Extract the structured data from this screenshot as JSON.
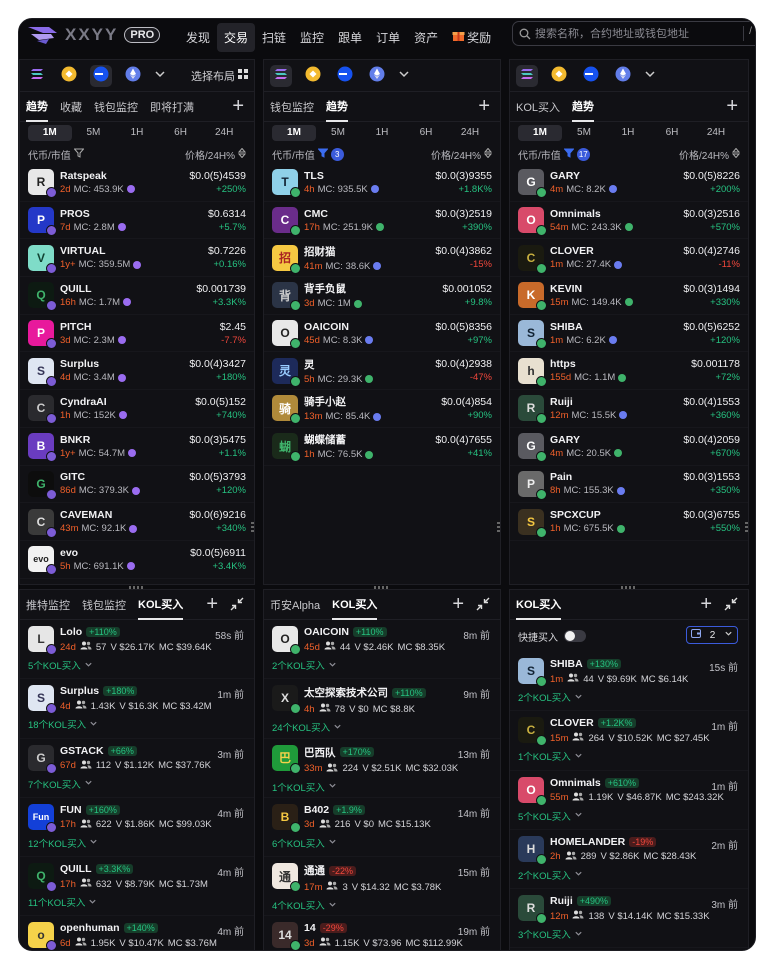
{
  "brand": {
    "logo_text": "XXYY",
    "badge": "PRO"
  },
  "nav": [
    "发现",
    "交易",
    "扫链",
    "监控",
    "跟单",
    "订单",
    "资产",
    "奖励"
  ],
  "nav_active": 1,
  "search": {
    "placeholder": "搜索名称，合约地址或钱包地址",
    "shortcut": "/"
  },
  "colors": {
    "up": "#26c281",
    "down": "#f0473c",
    "age": "#f0602a",
    "accent": "#3b5bdb"
  },
  "layout_label": "选择布局",
  "timeframes": [
    "1M",
    "5M",
    "1H",
    "6H",
    "24H"
  ],
  "sort": {
    "left": "代币/市值",
    "right": "价格/24H%"
  },
  "panels": [
    {
      "tabs": [
        "趋势",
        "收藏",
        "钱包监控",
        "即将打满"
      ],
      "active_tab": 0,
      "filter_count": "",
      "tokens": [
        {
          "name": "Ratspeak",
          "age": "2d",
          "mc": "MC: 453.9K",
          "price": "$0.0(5)4539",
          "chg": "+250%",
          "dir": "up",
          "bg": "#e8e8e8",
          "fg": "#222",
          "glyph": "R"
        },
        {
          "name": "PROS",
          "age": "7d",
          "mc": "MC: 2.8M",
          "price": "$0.6314",
          "chg": "+5.7%",
          "dir": "up",
          "bg": "#2438c8",
          "fg": "#fff",
          "glyph": "P"
        },
        {
          "name": "VIRTUAL",
          "age": "1y+",
          "mc": "MC: 359.5M",
          "price": "$0.7226",
          "chg": "+0.16%",
          "dir": "up",
          "bg": "#7fdcc8",
          "fg": "#143",
          "glyph": "V"
        },
        {
          "name": "QUILL",
          "age": "16h",
          "mc": "MC: 1.7M",
          "price": "$0.001739",
          "chg": "+3.3K%",
          "dir": "up",
          "bg": "#0d1a12",
          "fg": "#3fb36b",
          "glyph": "Q"
        },
        {
          "name": "PITCH",
          "age": "3d",
          "mc": "MC: 2.3M",
          "price": "$2.45",
          "chg": "-7.7%",
          "dir": "down",
          "bg": "#e8199c",
          "fg": "#fff",
          "glyph": "P"
        },
        {
          "name": "Surplus",
          "age": "4d",
          "mc": "MC: 3.4M",
          "price": "$0.0(4)3427",
          "chg": "+180%",
          "dir": "up",
          "bg": "#dfe6f2",
          "fg": "#335",
          "glyph": "S"
        },
        {
          "name": "CyndraAI",
          "age": "1h",
          "mc": "MC: 152K",
          "price": "$0.0(5)152",
          "chg": "+740%",
          "dir": "up",
          "bg": "#2a2a2e",
          "fg": "#ccc",
          "glyph": "C"
        },
        {
          "name": "BNKR",
          "age": "1y+",
          "mc": "MC: 54.7M",
          "price": "$0.0(3)5475",
          "chg": "+1.1%",
          "dir": "up",
          "bg": "#6a3cc0",
          "fg": "#fff",
          "glyph": "B"
        },
        {
          "name": "GITC",
          "age": "86d",
          "mc": "MC: 379.3K",
          "price": "$0.0(5)3793",
          "chg": "+120%",
          "dir": "up",
          "bg": "#0d0d0d",
          "fg": "#3fb36b",
          "glyph": "G"
        },
        {
          "name": "CAVEMAN",
          "age": "43m",
          "mc": "MC: 92.1K",
          "price": "$0.0(6)9216",
          "chg": "+340%",
          "dir": "up",
          "bg": "#3a3a3a",
          "fg": "#ddd",
          "glyph": "C"
        },
        {
          "name": "evo",
          "age": "5h",
          "mc": "MC: 691.1K",
          "price": "$0.0(5)6911",
          "chg": "+3.4K%",
          "dir": "up",
          "bg": "#f2f2f2",
          "fg": "#222",
          "glyph": "evo"
        }
      ],
      "kol_tabs": [
        "推特监控",
        "钱包监控",
        "KOL买入"
      ],
      "kol_active": 2,
      "kols": [
        {
          "name": "Lolo",
          "pct": "+110%",
          "neg": false,
          "age": "24d",
          "holders": "57",
          "vol": "V $26.17K",
          "mc": "MC $39.64K",
          "time": "58s 前",
          "count": "5个KOL买入",
          "bg": "#e6e6e6",
          "fg": "#333",
          "glyph": "L"
        },
        {
          "name": "Surplus",
          "pct": "+180%",
          "neg": false,
          "age": "4d",
          "holders": "1.43K",
          "vol": "V $16.3K",
          "mc": "MC $3.42M",
          "time": "1m 前",
          "count": "18个KOL买入",
          "bg": "#dfe6f2",
          "fg": "#335",
          "glyph": "S"
        },
        {
          "name": "GSTACK",
          "pct": "+66%",
          "neg": false,
          "age": "67d",
          "holders": "112",
          "vol": "V $1.12K",
          "mc": "MC $37.76K",
          "time": "3m 前",
          "count": "7个KOL买入",
          "bg": "#2a2a2e",
          "fg": "#ccc",
          "glyph": "G"
        },
        {
          "name": "FUN",
          "pct": "+160%",
          "neg": false,
          "age": "17h",
          "holders": "622",
          "vol": "V $1.86K",
          "mc": "MC $99.03K",
          "time": "4m 前",
          "count": "12个KOL买入",
          "bg": "#1340d8",
          "fg": "#fff",
          "glyph": "Fun"
        },
        {
          "name": "QUILL",
          "pct": "+3.3K%",
          "neg": false,
          "age": "17h",
          "holders": "632",
          "vol": "V $8.79K",
          "mc": "MC $1.73M",
          "time": "4m 前",
          "count": "11个KOL买入",
          "bg": "#0d1a12",
          "fg": "#3fb36b",
          "glyph": "Q"
        },
        {
          "name": "openhuman",
          "pct": "+140%",
          "neg": false,
          "age": "6d",
          "holders": "1.95K",
          "vol": "V $10.47K",
          "mc": "MC $3.76M",
          "time": "4m 前",
          "count": "",
          "bg": "#f5d24a",
          "fg": "#333",
          "glyph": "o"
        }
      ]
    },
    {
      "tabs": [
        "钱包监控",
        "趋势"
      ],
      "active_tab": 1,
      "filter_count": "3",
      "tokens": [
        {
          "name": "TLS",
          "age": "4h",
          "mc": "MC: 935.5K",
          "price": "$0.0(3)9355",
          "chg": "+1.8K%",
          "dir": "up",
          "bg": "#8fd0e8",
          "fg": "#123",
          "glyph": "T"
        },
        {
          "name": "CMC",
          "age": "17h",
          "mc": "MC: 251.9K",
          "price": "$0.0(3)2519",
          "chg": "+390%",
          "dir": "up",
          "bg": "#6a2c8a",
          "fg": "#fff",
          "glyph": "C"
        },
        {
          "name": "招财猫",
          "age": "41m",
          "mc": "MC: 38.6K",
          "price": "$0.0(4)3862",
          "chg": "-15%",
          "dir": "down",
          "bg": "#f5c842",
          "fg": "#a22",
          "glyph": "招"
        },
        {
          "name": "背手负鼠",
          "age": "3d",
          "mc": "MC: 1M",
          "price": "$0.001052",
          "chg": "+9.8%",
          "dir": "up",
          "bg": "#2b3446",
          "fg": "#ccc",
          "glyph": "背"
        },
        {
          "name": "OAICOIN",
          "age": "45d",
          "mc": "MC: 8.3K",
          "price": "$0.0(5)8356",
          "chg": "+97%",
          "dir": "up",
          "bg": "#e8e8e8",
          "fg": "#222",
          "glyph": "O"
        },
        {
          "name": "灵",
          "age": "5h",
          "mc": "MC: 29.3K",
          "price": "$0.0(4)2938",
          "chg": "-47%",
          "dir": "down",
          "bg": "#1d2a5a",
          "fg": "#9cf",
          "glyph": "灵"
        },
        {
          "name": "骑手小赵",
          "age": "13m",
          "mc": "MC: 85.4K",
          "price": "$0.0(4)854",
          "chg": "+90%",
          "dir": "up",
          "bg": "#b08a3a",
          "fg": "#fff",
          "glyph": "骑"
        },
        {
          "name": "蝴蝶储蓄",
          "age": "1h",
          "mc": "MC: 76.5K",
          "price": "$0.0(4)7655",
          "chg": "+41%",
          "dir": "up",
          "bg": "#1a2a1a",
          "fg": "#3fb36b",
          "glyph": "蝴"
        }
      ],
      "kol_tabs": [
        "币安Alpha",
        "KOL买入"
      ],
      "kol_active": 1,
      "kols": [
        {
          "name": "OAICOIN",
          "pct": "+110%",
          "neg": false,
          "age": "45d",
          "holders": "44",
          "vol": "V $2.46K",
          "mc": "MC $8.35K",
          "time": "8m 前",
          "count": "2个KOL买入",
          "bg": "#e8e8e8",
          "fg": "#222",
          "glyph": "O"
        },
        {
          "name": "太空探索技术公司",
          "pct": "+110%",
          "neg": false,
          "age": "4h",
          "holders": "78",
          "vol": "V $0",
          "mc": "MC $8.8K",
          "time": "9m 前",
          "count": "24个KOL买入",
          "bg": "#1a1a1a",
          "fg": "#ddd",
          "glyph": "X"
        },
        {
          "name": "巴西队",
          "pct": "+170%",
          "neg": false,
          "age": "33m",
          "holders": "224",
          "vol": "V $2.51K",
          "mc": "MC $32.03K",
          "time": "13m 前",
          "count": "1个KOL买入",
          "bg": "#1f9a3a",
          "fg": "#f5d24a",
          "glyph": "巴"
        },
        {
          "name": "B402",
          "pct": "+1.9%",
          "neg": false,
          "age": "3d",
          "holders": "216",
          "vol": "V $0",
          "mc": "MC $15.13K",
          "time": "14m 前",
          "count": "6个KOL买入",
          "bg": "#2a2016",
          "fg": "#f5c842",
          "glyph": "B"
        },
        {
          "name": "通通",
          "pct": "-22%",
          "neg": true,
          "age": "17m",
          "holders": "3",
          "vol": "V $14.32",
          "mc": "MC $3.78K",
          "time": "15m 前",
          "count": "4个KOL买入",
          "bg": "#f0e8e0",
          "fg": "#333",
          "glyph": "通"
        },
        {
          "name": "14",
          "pct": "-29%",
          "neg": true,
          "age": "3d",
          "holders": "1.15K",
          "vol": "V $73.96",
          "mc": "MC $112.99K",
          "time": "19m 前",
          "count": "",
          "bg": "#3a2a2a",
          "fg": "#ddd",
          "glyph": "14"
        }
      ]
    },
    {
      "tabs": [
        "KOL买入",
        "趋势"
      ],
      "active_tab": 1,
      "filter_count": "17",
      "tokens": [
        {
          "name": "GARY",
          "age": "4m",
          "mc": "MC: 8.2K",
          "price": "$0.0(5)8226",
          "chg": "+200%",
          "dir": "up",
          "bg": "#5a5a60",
          "fg": "#fff",
          "glyph": "G"
        },
        {
          "name": "Omnimals",
          "age": "54m",
          "mc": "MC: 243.3K",
          "price": "$0.0(3)2516",
          "chg": "+570%",
          "dir": "up",
          "bg": "#d84a6a",
          "fg": "#fff",
          "glyph": "O"
        },
        {
          "name": "CLOVER",
          "age": "1m",
          "mc": "MC: 27.4K",
          "price": "$0.0(4)2746",
          "chg": "-11%",
          "dir": "down",
          "bg": "#1a1a10",
          "fg": "#c8b040",
          "glyph": "C"
        },
        {
          "name": "KEVIN",
          "age": "15m",
          "mc": "MC: 149.4K",
          "price": "$0.0(3)1494",
          "chg": "+330%",
          "dir": "up",
          "bg": "#c86a2a",
          "fg": "#fff",
          "glyph": "K"
        },
        {
          "name": "SHIBA",
          "age": "1m",
          "mc": "MC: 6.2K",
          "price": "$0.0(5)6252",
          "chg": "+120%",
          "dir": "up",
          "bg": "#9ab8d8",
          "fg": "#123",
          "glyph": "S"
        },
        {
          "name": "https",
          "age": "155d",
          "mc": "MC: 1.1M",
          "price": "$0.001178",
          "chg": "+72%",
          "dir": "up",
          "bg": "#e8e0d0",
          "fg": "#333",
          "glyph": "h"
        },
        {
          "name": "Ruiji",
          "age": "12m",
          "mc": "MC: 15.5K",
          "price": "$0.0(4)1553",
          "chg": "+360%",
          "dir": "up",
          "bg": "#2a4a3a",
          "fg": "#ddd",
          "glyph": "R"
        },
        {
          "name": "GARY",
          "age": "4m",
          "mc": "MC: 20.5K",
          "price": "$0.0(4)2059",
          "chg": "+670%",
          "dir": "up",
          "bg": "#5a5a60",
          "fg": "#fff",
          "glyph": "G"
        },
        {
          "name": "Pain",
          "age": "8h",
          "mc": "MC: 155.3K",
          "price": "$0.0(3)1553",
          "chg": "+350%",
          "dir": "up",
          "bg": "#6a6a6a",
          "fg": "#eee",
          "glyph": "P"
        },
        {
          "name": "SPCXCUP",
          "age": "1h",
          "mc": "MC: 675.5K",
          "price": "$0.0(3)6755",
          "chg": "+550%",
          "dir": "up",
          "bg": "#3a3020",
          "fg": "#f5c842",
          "glyph": "S"
        }
      ],
      "kol_tabs": [
        "KOL买入"
      ],
      "kol_active": 0,
      "quick_buy": "快捷买入",
      "quick_amount": "2",
      "kols": [
        {
          "name": "SHIBA",
          "pct": "+130%",
          "neg": false,
          "age": "1m",
          "holders": "44",
          "vol": "V $9.69K",
          "mc": "MC $6.14K",
          "time": "15s 前",
          "count": "2个KOL买入",
          "bg": "#9ab8d8",
          "fg": "#123",
          "glyph": "S"
        },
        {
          "name": "CLOVER",
          "pct": "+1.2K%",
          "neg": false,
          "age": "15m",
          "holders": "264",
          "vol": "V $10.52K",
          "mc": "MC $27.45K",
          "time": "1m 前",
          "count": "1个KOL买入",
          "bg": "#1a1a10",
          "fg": "#c8b040",
          "glyph": "C"
        },
        {
          "name": "Omnimals",
          "pct": "+610%",
          "neg": false,
          "age": "55m",
          "holders": "1.19K",
          "vol": "V $46.87K",
          "mc": "MC $243.32K",
          "time": "1m 前",
          "count": "5个KOL买入",
          "bg": "#d84a6a",
          "fg": "#fff",
          "glyph": "O"
        },
        {
          "name": "HOMELANDER",
          "pct": "-19%",
          "neg": true,
          "age": "2h",
          "holders": "289",
          "vol": "V $2.86K",
          "mc": "MC $28.43K",
          "time": "2m 前",
          "count": "2个KOL买入",
          "bg": "#2a3a5a",
          "fg": "#ddd",
          "glyph": "H"
        },
        {
          "name": "Ruiji",
          "pct": "+490%",
          "neg": false,
          "age": "12m",
          "holders": "138",
          "vol": "V $14.14K",
          "mc": "MC $15.33K",
          "time": "3m 前",
          "count": "3个KOL买入",
          "bg": "#2a4a3a",
          "fg": "#ddd",
          "glyph": "R"
        }
      ]
    }
  ]
}
